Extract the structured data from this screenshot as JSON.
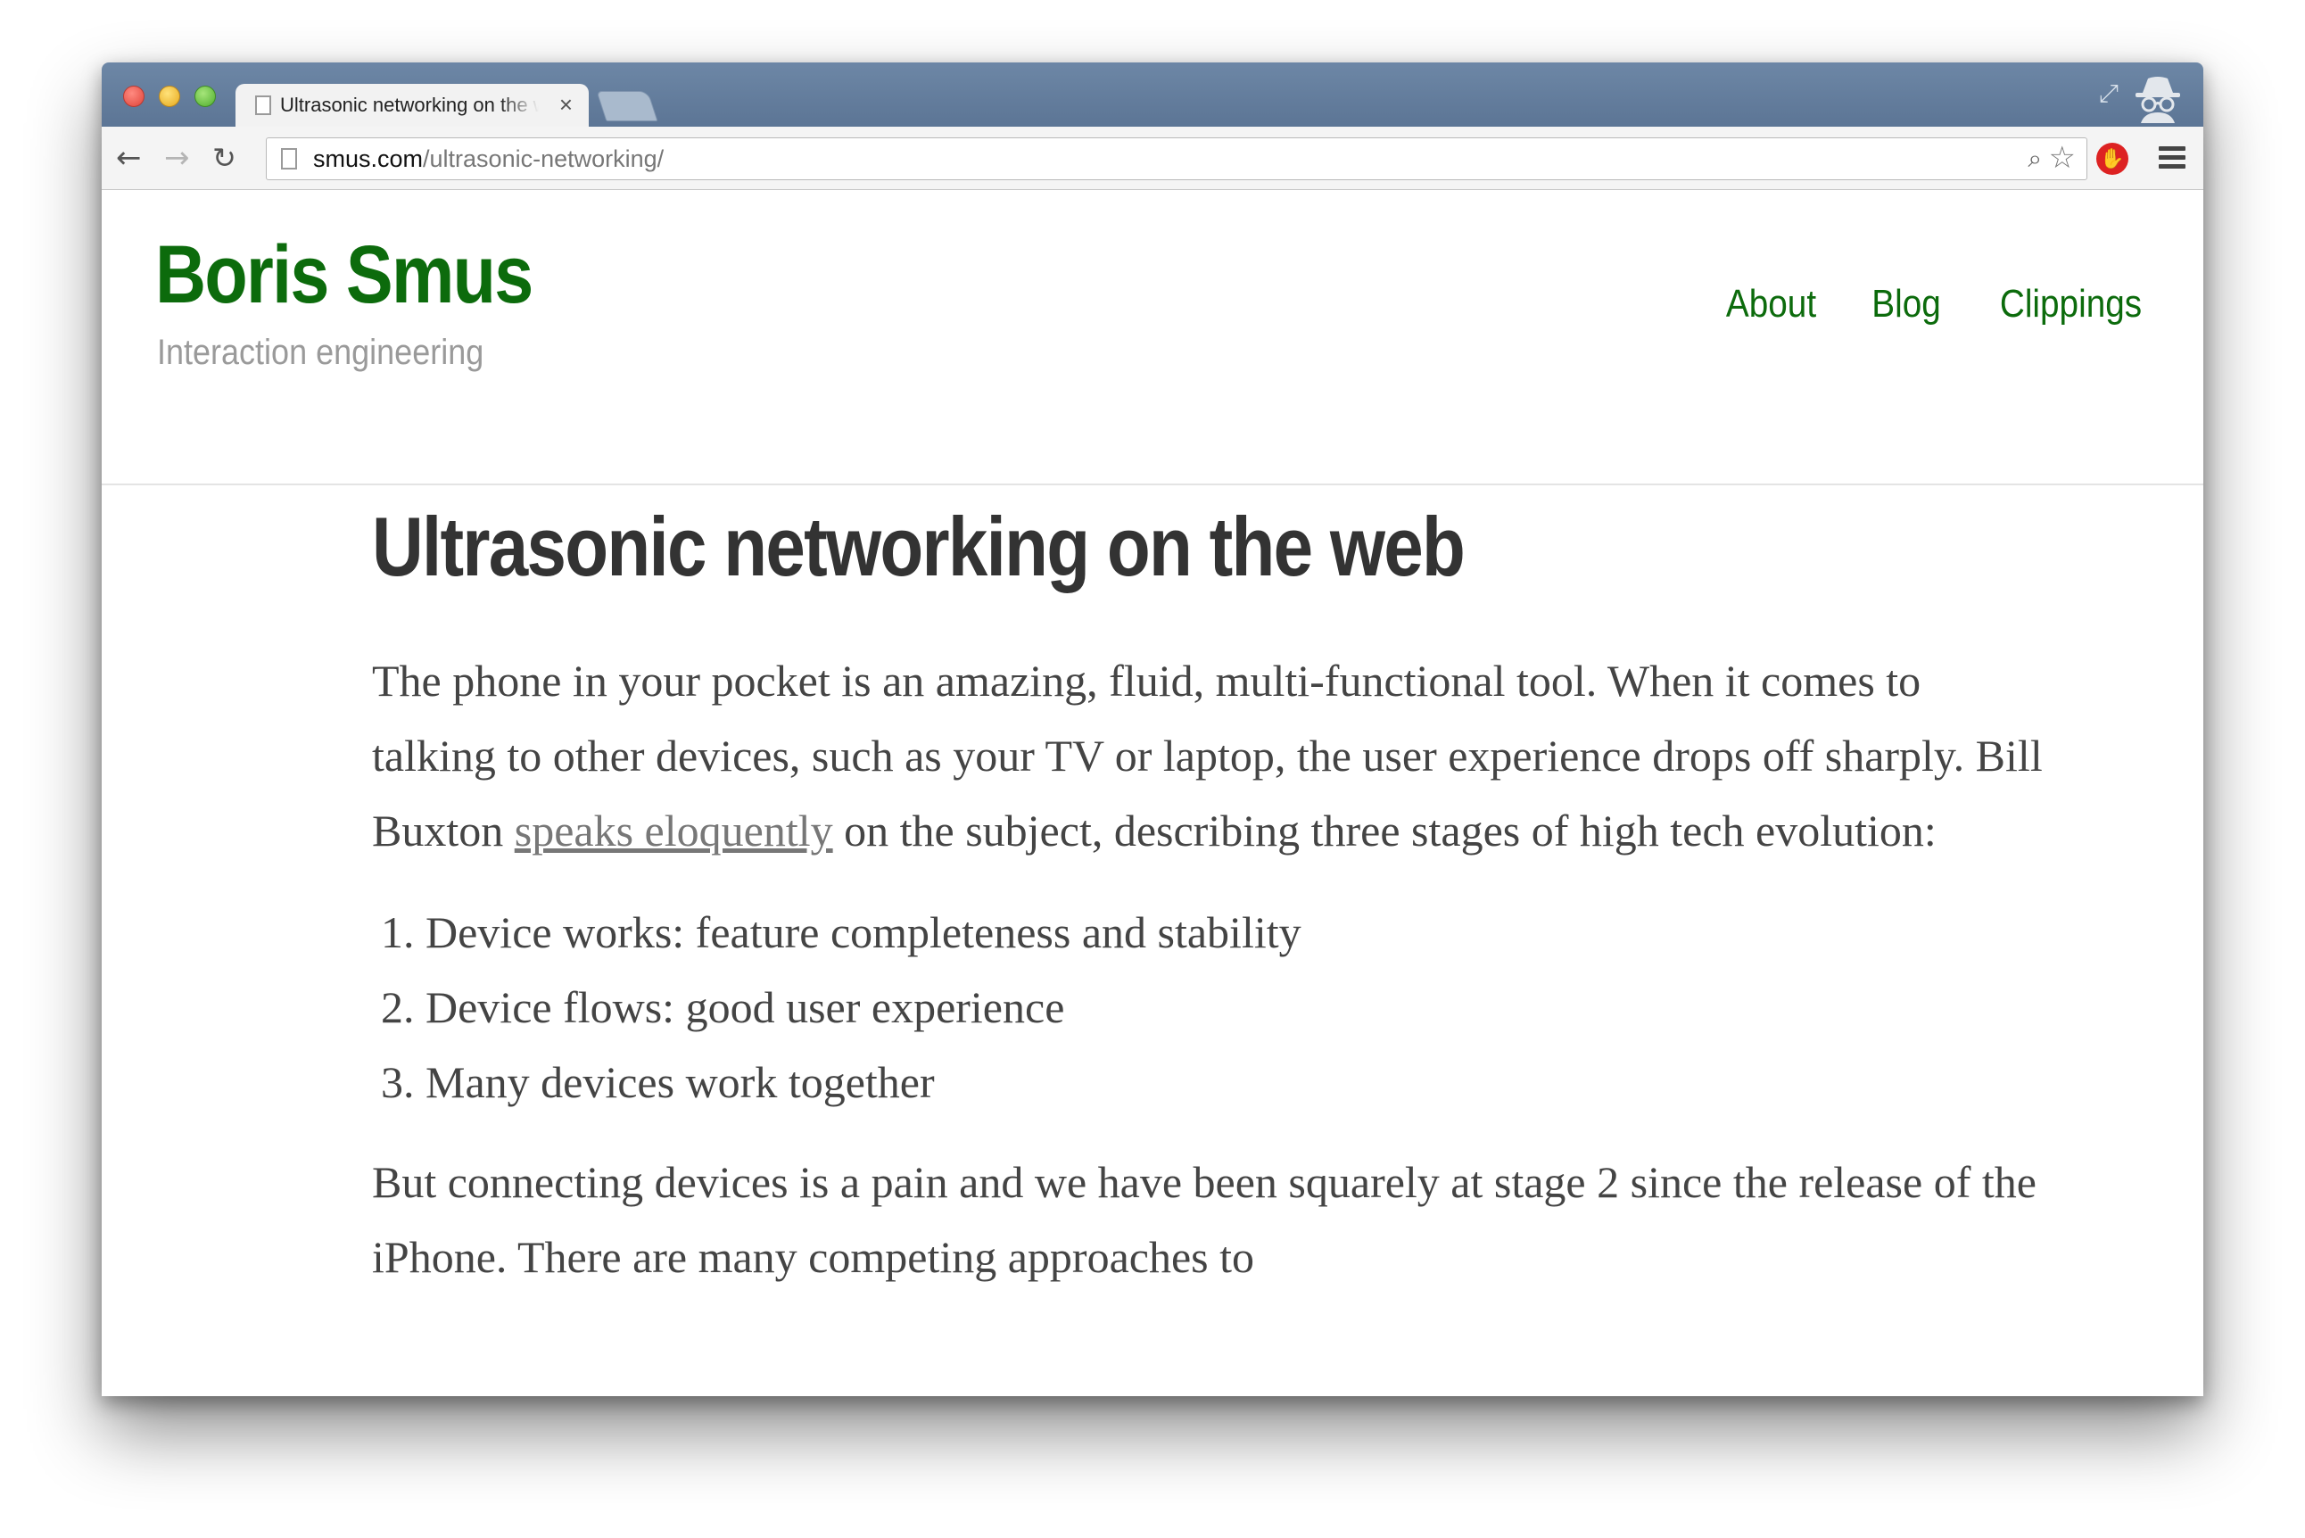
{
  "browser": {
    "tab_title": "Ultrasonic networking on the web",
    "tab_close": "×",
    "url_host": "smus.com",
    "url_path": "/ultrasonic-networking/",
    "icons": {
      "back": "back-arrow-icon",
      "forward": "forward-arrow-icon",
      "reload": "reload-icon",
      "zoom": "zoom-icon",
      "bookmark": "star-icon",
      "extension": "adblock-icon",
      "menu": "menu-icon",
      "fullscreen": "fullscreen-icon",
      "incognito": "incognito-icon"
    }
  },
  "site": {
    "title": "Boris Smus",
    "tagline": "Interaction engineering",
    "nav": [
      "About",
      "Blog",
      "Clippings"
    ],
    "accent_color": "#0c6b0c"
  },
  "article": {
    "title": "Ultrasonic networking on the web",
    "p1_before_link": "The phone in your pocket is an amazing, fluid, multi-functional tool. When it comes to talking to other devices, such as your TV or laptop, the user experience drops off sharply. Bill Buxton ",
    "p1_link": "speaks eloquently",
    "p1_after_link": " on the subject, describing three stages of high tech evolution:",
    "list": [
      "Device works: feature completeness and stability",
      "Device flows: good user experience",
      "Many devices work together"
    ],
    "p2": "But connecting devices is a pain and we have been squarely at stage 2 since the release of the iPhone. There are many competing approaches to"
  }
}
